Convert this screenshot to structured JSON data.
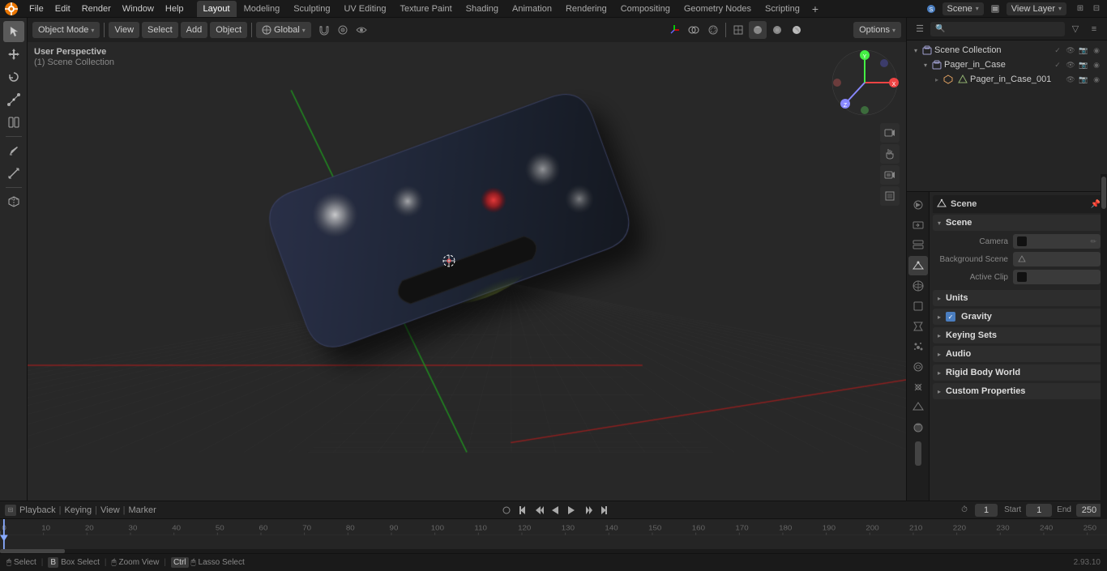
{
  "app": {
    "title": "Blender",
    "version": "2.93.10"
  },
  "menu": {
    "items": [
      "File",
      "Edit",
      "Render",
      "Window",
      "Help"
    ]
  },
  "workspace_tabs": {
    "tabs": [
      "Layout",
      "Modeling",
      "Sculpting",
      "UV Editing",
      "Texture Paint",
      "Shading",
      "Animation",
      "Rendering",
      "Compositing",
      "Geometry Nodes",
      "Scripting"
    ],
    "active": "Layout",
    "add_label": "+"
  },
  "scene": {
    "name": "Scene",
    "view_layer": "View Layer"
  },
  "viewport": {
    "mode": "Object Mode",
    "view_label": "View",
    "select_label": "Select",
    "add_label": "Add",
    "object_label": "Object",
    "transform": "Global",
    "breadcrumb_line1": "User Perspective",
    "breadcrumb_line2": "(1) Scene Collection",
    "options_label": "Options"
  },
  "outliner": {
    "header": "Scene Collection",
    "collection_name": "Scene Collection",
    "items": [
      {
        "name": "Pager_in_Case",
        "indent": 0,
        "type": "collection",
        "expanded": true
      },
      {
        "name": "Pager_in_Case_001",
        "indent": 1,
        "type": "object",
        "expanded": false
      }
    ]
  },
  "properties": {
    "header_icon": "scene",
    "header_title": "Scene",
    "sections": [
      {
        "name": "Scene",
        "expanded": true,
        "rows": [
          {
            "label": "Camera",
            "value": "",
            "has_swatch": true,
            "has_edit": true
          },
          {
            "label": "Background Scene",
            "value": "",
            "has_swatch": false,
            "has_camera": true
          },
          {
            "label": "Active Clip",
            "value": "",
            "has_swatch": true
          }
        ]
      },
      {
        "name": "Units",
        "expanded": false
      },
      {
        "name": "Gravity",
        "expanded": false,
        "has_checkbox": true,
        "checkbox_checked": true,
        "checkbox_label": "Gravity"
      },
      {
        "name": "Keying Sets",
        "expanded": false
      },
      {
        "name": "Audio",
        "expanded": false
      },
      {
        "name": "Rigid Body World",
        "expanded": false
      },
      {
        "name": "Custom Properties",
        "expanded": false
      }
    ]
  },
  "timeline": {
    "playback_label": "Playback",
    "keying_label": "Keying",
    "view_label": "View",
    "marker_label": "Marker",
    "current_frame": "1",
    "start_frame": "1",
    "end_frame": "250",
    "start_label": "Start",
    "end_label": "End"
  },
  "status_bar": {
    "select_label": "Select",
    "box_select_label": "Box Select",
    "zoom_view_label": "Zoom View",
    "lasso_label": "Lasso Select",
    "version": "2.93.10",
    "mouse_icon": "🖱"
  },
  "icons": {
    "blender": "●",
    "cursor": "⊕",
    "move": "✛",
    "rotate": "↻",
    "scale": "⤡",
    "transform": "⊞",
    "annotate": "✏",
    "measure": "📐",
    "arrow_right": "▶",
    "arrow_down": "▾",
    "camera": "📷",
    "scene_icon": "🎬",
    "expand": "▸",
    "collapse": "▾",
    "collection_icon": "▣",
    "object_icon": "□",
    "mesh_icon": "△",
    "eye": "👁",
    "camera_sm": "📷",
    "render": "🎥",
    "pin": "📌",
    "filter": "≡",
    "search": "🔍",
    "close": "✕",
    "lock": "🔒",
    "funnel": "▽",
    "dot": "●"
  },
  "ruler_marks": [
    "0",
    "10",
    "20",
    "30",
    "40",
    "50",
    "60",
    "70",
    "80",
    "90",
    "100",
    "110",
    "120",
    "130",
    "140",
    "150",
    "160",
    "170",
    "180",
    "190",
    "200",
    "210",
    "220",
    "230",
    "240",
    "250"
  ],
  "props_side_tabs": [
    {
      "id": "render",
      "icon": "🎥",
      "tooltip": "Render"
    },
    {
      "id": "output",
      "icon": "📤",
      "tooltip": "Output"
    },
    {
      "id": "view_layer",
      "icon": "◫",
      "tooltip": "View Layer"
    },
    {
      "id": "scene",
      "icon": "🎬",
      "tooltip": "Scene",
      "active": true
    },
    {
      "id": "world",
      "icon": "🌐",
      "tooltip": "World"
    },
    {
      "id": "object",
      "icon": "□",
      "tooltip": "Object"
    },
    {
      "id": "modifiers",
      "icon": "🔧",
      "tooltip": "Modifiers"
    },
    {
      "id": "particles",
      "icon": "✦",
      "tooltip": "Particles"
    },
    {
      "id": "physics",
      "icon": "⚛",
      "tooltip": "Physics"
    },
    {
      "id": "constraints",
      "icon": "🔗",
      "tooltip": "Constraints"
    },
    {
      "id": "data",
      "icon": "△",
      "tooltip": "Data"
    },
    {
      "id": "material",
      "icon": "○",
      "tooltip": "Material"
    }
  ]
}
